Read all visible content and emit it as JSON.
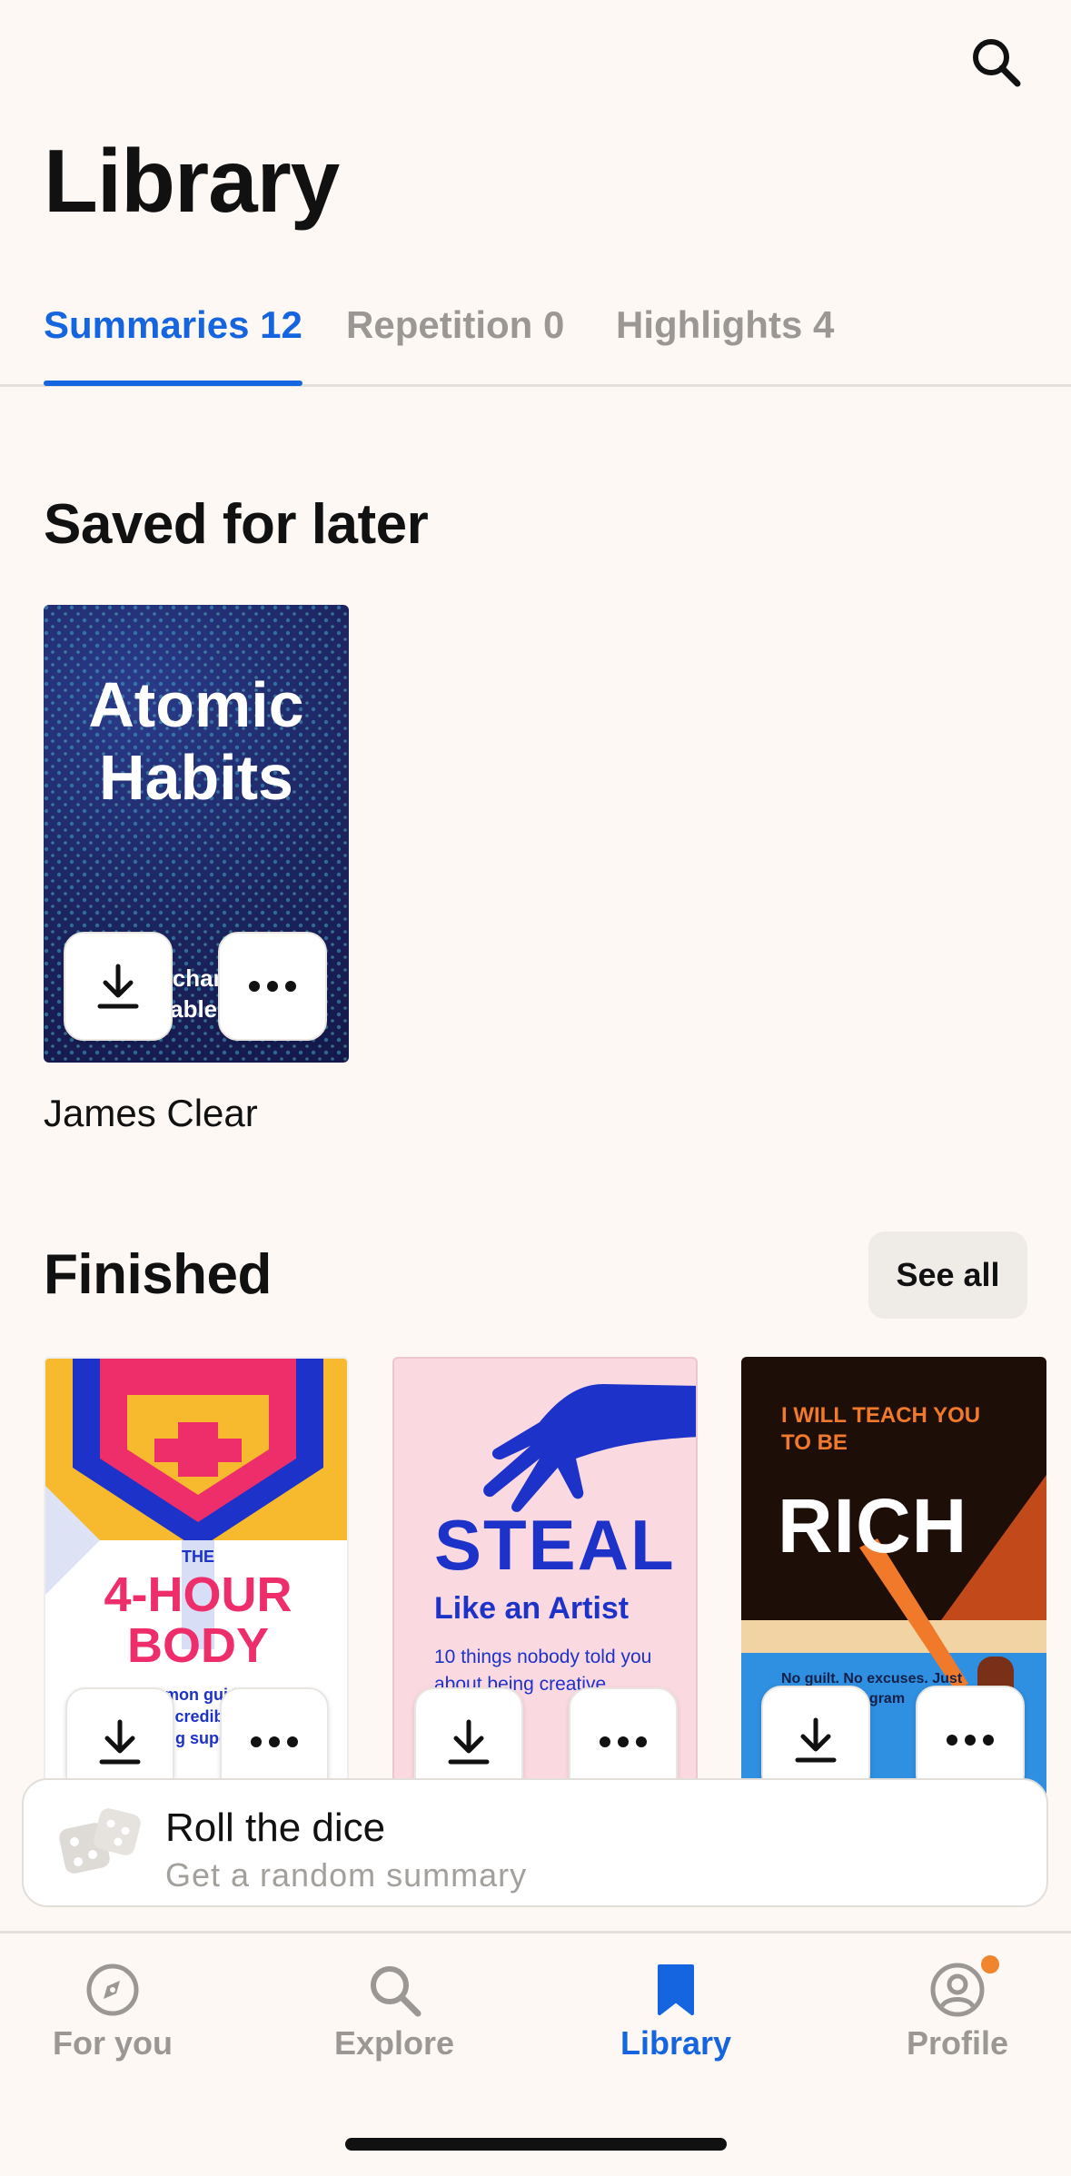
{
  "header": {
    "title": "Library",
    "search_icon": "search-icon"
  },
  "tabs": [
    {
      "label": "Summaries 12",
      "active": true
    },
    {
      "label": "Repetition 0",
      "active": false
    },
    {
      "label": "Highlights 4",
      "active": false
    }
  ],
  "saved": {
    "title": "Saved for later",
    "books": [
      {
        "cover_title": "Atomic Habits",
        "cover_line1": "Tiny changes,",
        "cover_line2": "remarkable results",
        "author": "James Clear"
      }
    ]
  },
  "finished": {
    "title": "Finished",
    "see_all": "See all",
    "books": [
      {
        "cover_small": "THE",
        "cover_line1": "4-HOUR",
        "cover_line2": "BODY",
        "cover_text": "An uncommon guide to rapid fat-loss, incredible sex and becoming superhuman"
      },
      {
        "cover_line1": "STEAL",
        "cover_line2": "Like an Artist",
        "cover_text": "10 things nobody told you about being creative"
      },
      {
        "cover_small": "I WILL TEACH YOU TO BE",
        "cover_line1": "RICH",
        "cover_text": "No guilt. No excuses. Just a 6-week program"
      }
    ]
  },
  "roll": {
    "title": "Roll the dice",
    "subtitle": "Get a random summary"
  },
  "nav": [
    {
      "label": "For you",
      "icon": "compass-icon",
      "active": false
    },
    {
      "label": "Explore",
      "icon": "search-icon",
      "active": false
    },
    {
      "label": "Library",
      "icon": "bookmark-icon",
      "active": true
    },
    {
      "label": "Profile",
      "icon": "user-icon",
      "active": false,
      "badge": true
    }
  ],
  "colors": {
    "accent": "#1565e0",
    "background": "#fdf8f3",
    "notification": "#f0852d"
  }
}
